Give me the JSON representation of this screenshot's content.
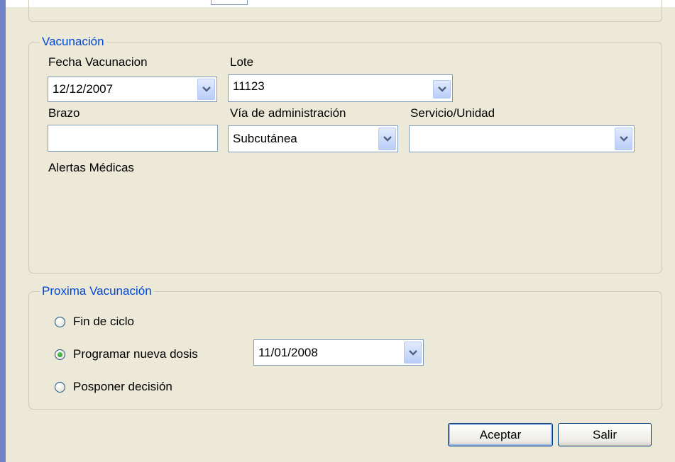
{
  "vacunacion": {
    "legend": "Vacunación",
    "fecha_label": "Fecha Vacunacion",
    "fecha_value": "12/12/2007",
    "lote_label": "Lote",
    "lote_value": "11123",
    "brazo_label": "Brazo",
    "brazo_value": "",
    "via_label": "Vía de administración",
    "via_value": "Subcutánea",
    "servicio_label": "Servicio/Unidad",
    "servicio_value": "",
    "alertas_label": "Alertas Médicas"
  },
  "proxima": {
    "legend": "Proxima Vacunación",
    "options": [
      {
        "label": "Fin de ciclo",
        "selected": false
      },
      {
        "label": "Programar nueva dosis",
        "selected": true
      },
      {
        "label": "Posponer decisión",
        "selected": false
      }
    ],
    "fecha_value": "11/01/2008"
  },
  "buttons": {
    "aceptar": "Aceptar",
    "salir": "Salir"
  },
  "colors": {
    "window_bg": "#ece9d8",
    "legend_text": "#0046d5",
    "left_bar": "#6f83c6",
    "radio_dot": "#1c8a1a"
  }
}
